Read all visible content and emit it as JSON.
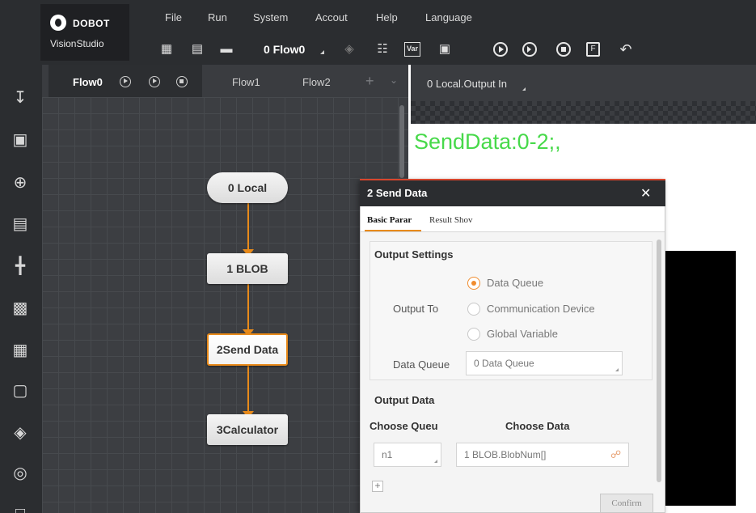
{
  "app": {
    "brand": "DOBOT",
    "product": "VisionStudio"
  },
  "menu": [
    "File",
    "Run",
    "System",
    "Accout",
    "Help",
    "Language"
  ],
  "toolbar": {
    "flow_selector": "0 Flow0",
    "icons": [
      "new-solution-icon",
      "save-icon",
      "open-folder-icon",
      "layers-icon",
      "network-icon",
      "variable-icon",
      "device-icon",
      "run-once-icon",
      "run-continuous-icon",
      "stop-icon",
      "format-icon",
      "undo-icon"
    ],
    "var_label": "Var"
  },
  "sidebar": {
    "icons": [
      "tool-settings-icon",
      "camera-icon",
      "positioning-icon",
      "measurement-icon",
      "alignment-icon",
      "recognition-icon",
      "calibration-icon",
      "image-processing-icon",
      "color-fill-icon",
      "logic-icon",
      "communication-icon"
    ]
  },
  "flow_tabs": {
    "active": "Flow0",
    "tabs": [
      "Flow1",
      "Flow2"
    ],
    "plus": "+",
    "chevron": "⌄"
  },
  "flow_nodes": [
    {
      "label": "0 Local",
      "shape": "round"
    },
    {
      "label": "1 BLOB",
      "shape": "rect"
    },
    {
      "label": "2Send Data",
      "shape": "rect",
      "selected": true
    },
    {
      "label": "3Calculator",
      "shape": "rect"
    }
  ],
  "result_panel": {
    "title": "0 Local.Output In",
    "output_text": "SendData:0-2;,"
  },
  "dialog": {
    "title": "2 Send Data",
    "close": "✕",
    "tabs": [
      "Basic Parar",
      "Result Shov"
    ],
    "output_settings": {
      "title": "Output Settings",
      "output_to_label": "Output To",
      "options": [
        {
          "label": "Data Queue",
          "selected": true
        },
        {
          "label": "Communication Device",
          "selected": false
        },
        {
          "label": "Global Variable",
          "selected": false
        }
      ],
      "data_queue_label": "Data Queue",
      "data_queue_value": "0 Data Queue"
    },
    "output_data": {
      "title": "Output Data",
      "col_queue": "Choose Queu",
      "col_data": "Choose Data",
      "row_queue_value": "n1",
      "row_data_value": "1 BLOB.BlobNum[]"
    },
    "add": "+",
    "confirm": "Confirm"
  },
  "colors": {
    "accent": "#e88a1a",
    "chrome": "#2b2d30",
    "output_text": "#47d94a",
    "dialog_border": "#d7462d"
  }
}
